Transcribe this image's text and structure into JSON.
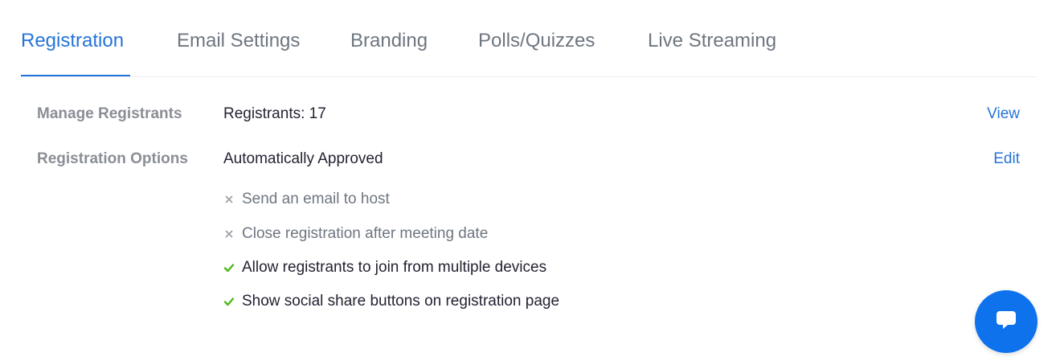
{
  "tabs": [
    {
      "label": "Registration",
      "active": true
    },
    {
      "label": "Email Settings",
      "active": false
    },
    {
      "label": "Branding",
      "active": false
    },
    {
      "label": "Polls/Quizzes",
      "active": false
    },
    {
      "label": "Live Streaming",
      "active": false
    }
  ],
  "manage_registrants": {
    "label": "Manage Registrants",
    "value": "Registrants: 17",
    "action": "View"
  },
  "registration_options": {
    "label": "Registration Options",
    "value": "Automatically Approved",
    "action": "Edit",
    "options": [
      {
        "text": "Send an email to host",
        "enabled": false,
        "icon": "x-icon"
      },
      {
        "text": "Close registration after meeting date",
        "enabled": false,
        "icon": "x-icon"
      },
      {
        "text": "Allow registrants to join from multiple devices",
        "enabled": true,
        "icon": "check-icon"
      },
      {
        "text": "Show social share buttons on registration page",
        "enabled": true,
        "icon": "check-icon"
      }
    ]
  },
  "chat_button": {
    "icon": "chat-bubble-icon"
  },
  "colors": {
    "accent": "#2574d9",
    "check": "#4cb81b",
    "muted": "#8a8e95",
    "fab": "#0e72ed"
  }
}
